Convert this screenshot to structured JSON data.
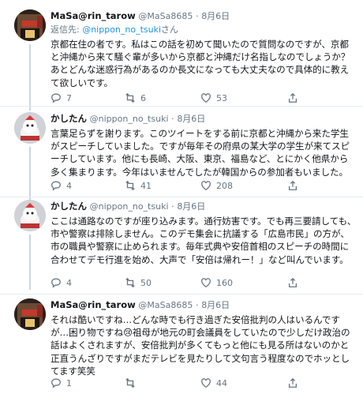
{
  "tweets": [
    {
      "name": "MaSa@rin_tarow",
      "handle": "@MaSa8685",
      "dot": "·",
      "date": "8月6日",
      "reply_prefix": "返信先: ",
      "reply_handle": "@nippon_no_tsuki",
      "reply_suffix": "さん",
      "text": "京都在住の者です。私はこの話を初めて聞いたので質問なのですが、京都と沖縄から来て騒ぐ輩が多いから京都と沖縄だけ名指しなのでしょうか？あとどんな迷惑行為があるのか長文になっても大丈夫なので具体的に教えて欲しいです。",
      "replies": "7",
      "retweets": "6",
      "likes": "53"
    },
    {
      "name": "かしたん",
      "handle": "@nippon_no_tsuki",
      "dot": "·",
      "date": "8月6日",
      "text": "言葉足らずを謝ります。このツイートをする前に京都と沖縄から来た学生がスピーチしていました。ですが毎年その府県の某大学の学生が来てスピーチしています。他にも長崎、大阪、東京、福島など、とにかく他県から多く集まります。今年はいませんでしたが韓国からの参加者もいました。",
      "replies": "4",
      "retweets": "41",
      "likes": "208"
    },
    {
      "name": "かしたん",
      "handle": "@nippon_no_tsuki",
      "dot": "·",
      "date": "8月6日",
      "text": "ここは通路なのですが座り込みます。通行妨害です。でも再三要請しても、市や警察は排除しません。このデモ集会に抗議する「広島市民」の方が、市の職員や警察に止められます。毎年式典や安倍首相のスピーチの時間に合わせてデモ行進を始め、大声で「安倍は帰れー！」など叫んでいます。",
      "replies": "4",
      "retweets": "50",
      "likes": "160"
    },
    {
      "name": "MaSa@rin_tarow",
      "handle": "@MaSa8685",
      "dot": "·",
      "date": "8月6日",
      "text": "それは酷いですね…どんな時でも行き過ぎた安倍批判の人はいるんですが…困り物ですね😢祖母が地元の町会議員をしていたので少しだけ政治の話はよくされますが、安倍批判が多くてもっと他にも見る所はないのかと正直うんざりですがまだテレビを見たりして文句言う程度なのでホッとしてます笑笑",
      "replies": "1",
      "retweets": "",
      "likes": "44"
    }
  ]
}
